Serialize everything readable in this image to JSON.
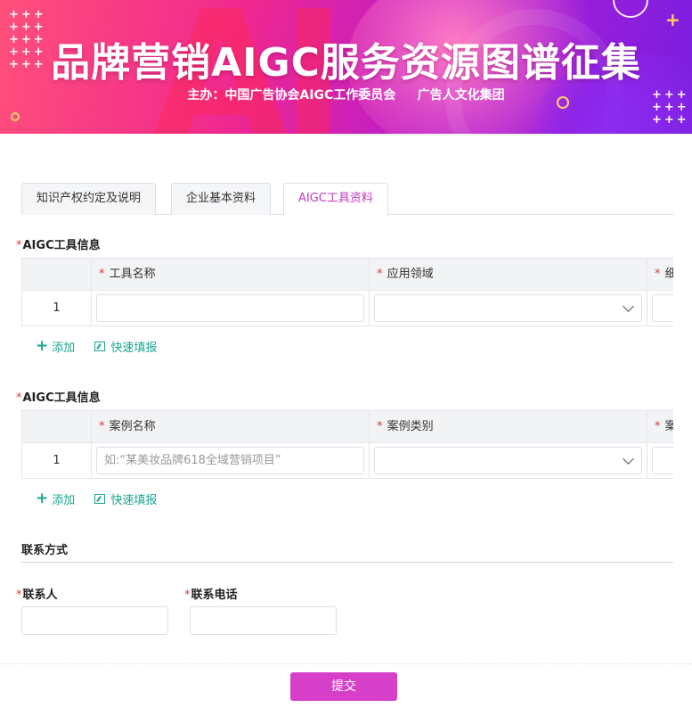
{
  "banner": {
    "title": "品牌营销AIGC服务资源图谱征集",
    "subtitle": "主办：中国广告协会AIGC工作委员会     广告人文化集团",
    "bg_letters": "AI",
    "colors": {
      "pink": "#f0288f",
      "purple": "#7b1fe0"
    }
  },
  "tabs": [
    {
      "label": "知识产权约定及说明"
    },
    {
      "label": "企业基本资料"
    },
    {
      "label": "AIGC工具资料",
      "active": true
    }
  ],
  "required_mark": "*",
  "tool_section": {
    "title": "AIGC工具信息",
    "columns": [
      "工具名称",
      "应用领域",
      "细"
    ],
    "rows": [
      {
        "index": "1",
        "name_placeholder": ""
      }
    ],
    "actions": {
      "add": "添加",
      "quick": "快速填报"
    }
  },
  "case_section": {
    "title": "AIGC工具信息",
    "columns": [
      "案例名称",
      "案例类别",
      "案"
    ],
    "rows": [
      {
        "index": "1",
        "name_placeholder": "如:“某美妆品牌618全域营销项目”"
      }
    ],
    "actions": {
      "add": "添加",
      "quick": "快速填报"
    }
  },
  "contact": {
    "title": "联系方式",
    "person_label": "联系人",
    "phone_label": "联系电话"
  },
  "submit_label": "提交",
  "accent_color": "#d63fc8",
  "link_color": "#1aa78f"
}
